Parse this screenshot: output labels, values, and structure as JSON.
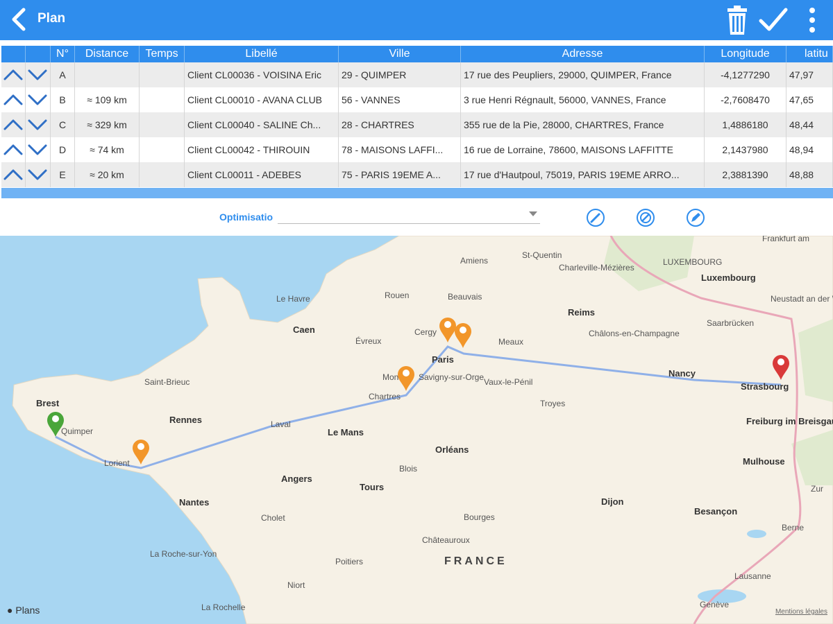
{
  "header": {
    "title": "Plan",
    "back_icon": "chevron-left-icon",
    "actions": [
      "trash-icon",
      "check-icon",
      "more-vertical-icon"
    ]
  },
  "table": {
    "columns": [
      "",
      "",
      "N°",
      "Distance",
      "Temps",
      "Libellé",
      "Ville",
      "Adresse",
      "Longitude",
      "latitu"
    ],
    "rows": [
      {
        "num": "A",
        "distance": "",
        "temps": "",
        "libelle": "Client CL00036 - VOISINA Eric",
        "ville": "29 - QUIMPER",
        "adresse": "17 rue des Peupliers, 29000, QUIMPER, France",
        "longitude": "-4,1277290",
        "latitude": "47,97"
      },
      {
        "num": "B",
        "distance": "≈ 109 km",
        "temps": "",
        "libelle": "Client CL00010 - AVANA CLUB",
        "ville": "56 - VANNES",
        "adresse": "3 rue Henri Régnault, 56000, VANNES, France",
        "longitude": "-2,7608470",
        "latitude": "47,65"
      },
      {
        "num": "C",
        "distance": "≈ 329 km",
        "temps": "",
        "libelle": "Client CL00040 - SALINE Ch...",
        "ville": "28 - CHARTRES",
        "adresse": "355 rue de la Pie, 28000, CHARTRES, France",
        "longitude": "1,4886180",
        "latitude": "48,44"
      },
      {
        "num": "D",
        "distance": "≈ 74 km",
        "temps": "",
        "libelle": "Client CL00042 - THIROUIN",
        "ville": "78 - MAISONS LAFFI...",
        "adresse": "16 rue de Lorraine, 78600, MAISONS LAFFITTE",
        "longitude": "2,1437980",
        "latitude": "48,94"
      },
      {
        "num": "E",
        "distance": "≈ 20 km",
        "temps": "",
        "libelle": "Client CL00011 - ADEBES",
        "ville": "75 - PARIS 19EME A...",
        "adresse": "17 rue d'Hautpoul, 75019, PARIS 19EME ARRO...",
        "longitude": "2,3881390",
        "latitude": "48,88"
      }
    ]
  },
  "optimisation": {
    "label": "Optimisatio",
    "value": "",
    "icons": [
      "edit-circle-icon",
      "target-circle-icon",
      "pencil-circle-icon"
    ]
  },
  "map": {
    "cities": [
      "Frankfurt am",
      "Amiens",
      "St-Quentin",
      "Charleville-Mézières",
      "LUXEMBOURG",
      "Luxembourg",
      "Le Havre",
      "Rouen",
      "Beauvais",
      "Neustadt an der Weinstraße",
      "Caen",
      "Cergy",
      "Reims",
      "Saarbrücken",
      "Évreux",
      "Meaux",
      "Châlons-en-Champagne",
      "Paris",
      "Nancy",
      "Saint-Brieuc",
      "Mont",
      "Savigny-sur-Orge",
      "Vaux-le-Pénil",
      "Strasbourg",
      "Brest",
      "Chartres",
      "Troyes",
      "Rennes",
      "Laval",
      "Freiburg im Breisgau",
      "Quimper",
      "Le Mans",
      "Lorient",
      "Orléans",
      "Mulhouse",
      "Blois",
      "Angers",
      "Tours",
      "Zur",
      "Nantes",
      "Dijon",
      "Cholet",
      "Bourges",
      "Besançon",
      "Châteauroux",
      "Berne",
      "La Roche-sur-Yon",
      "Poitiers",
      "Lausanne",
      "Niort",
      "Genève",
      "La Rochelle"
    ],
    "country": "FRANCE",
    "attribution": "Plans",
    "legal": "Mentions légales",
    "colors": {
      "route": "#8fb0e8",
      "pin_start": "#4aa63a",
      "pin_mid": "#f2962a",
      "pin_end": "#d93a3a",
      "sea": "#a8d6f2",
      "land": "#f6f1e6"
    }
  }
}
